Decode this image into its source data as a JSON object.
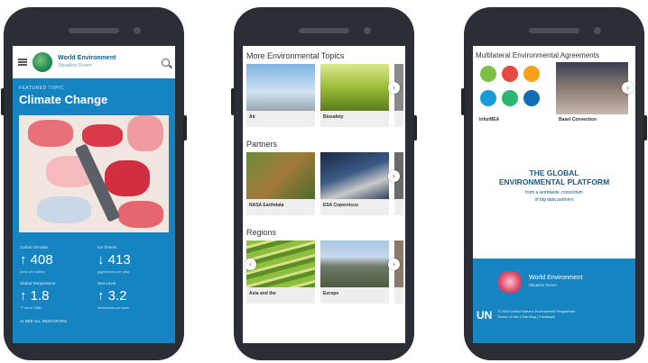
{
  "phone1": {
    "header": {
      "logo_line1": "World Environment",
      "logo_line2": "Situation Room"
    },
    "hero": {
      "kicker": "FEATURED TOPIC",
      "title": "Climate Change"
    },
    "stats": [
      {
        "label": "Carbon Dioxide",
        "value": "↑ 408",
        "sub": "parts per million"
      },
      {
        "label": "Ice Sheets",
        "value": "↓ 413",
        "sub": "gigatonnes per year"
      },
      {
        "label": "Global Temperature",
        "value": "↑ 1.8",
        "sub": "°F since 1880"
      },
      {
        "label": "Sea Level",
        "value": "↑ 3.2",
        "sub": "millimeters per year"
      }
    ],
    "more": "AI SEE ALL INDICATORS"
  },
  "phone2": {
    "sections": [
      {
        "title": "More Environmental Topics",
        "cards": [
          "Air",
          "Biosafety"
        ]
      },
      {
        "title": "Partners",
        "cards": [
          "NASA Earthdata",
          "ESA Copernicus"
        ]
      },
      {
        "title": "Regions",
        "cards": [
          "Asia and the",
          "Europe"
        ]
      }
    ]
  },
  "phone3": {
    "title": "Multilateral Environmental Agreements",
    "cards": [
      "InforMEA",
      "Basel Convention"
    ],
    "platform": {
      "line1": "THE GLOBAL",
      "line2": "ENVIRONMENTAL PLATFORM",
      "line3": "from a worldwide consortium",
      "line4": "of big data partners"
    },
    "footer": {
      "brand_line1": "World Environment",
      "brand_line2": "Situation Room",
      "un": "UN",
      "legal1": "© 2019 United Nations Environment Programme",
      "legal2": "Terms of Use | Site Map | Feedback"
    }
  },
  "colors": {
    "primary_blue": "#1784c2",
    "phone_body": "#2b2e34"
  }
}
